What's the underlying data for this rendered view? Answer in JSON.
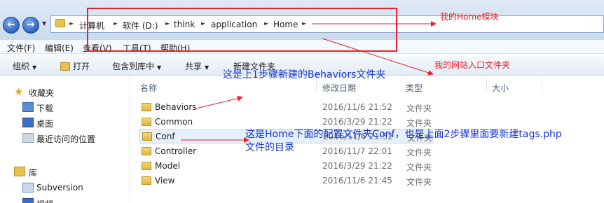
{
  "breadcrumb": {
    "items": [
      "计算机",
      "软件 (D:)",
      "think",
      "application",
      "Home"
    ]
  },
  "nav": {
    "back_icon": "back-arrow-icon",
    "forward_icon": "forward-arrow-icon"
  },
  "menubar": {
    "items": [
      "文件(F)",
      "编辑(E)",
      "查看(V)",
      "工具(T)",
      "帮助(H)"
    ]
  },
  "toolbar": {
    "organize": "组织",
    "open": "打开",
    "include_library": "包含到库中",
    "share": "共享",
    "new_folder": "新建文件夹"
  },
  "sidebar": {
    "favorites": "收藏夹",
    "items": [
      "下载",
      "桌面",
      "最近访问的位置"
    ],
    "library": "库",
    "library_items": [
      "Subversion",
      "视频"
    ]
  },
  "columns": {
    "name": "名称",
    "modified": "修改日期",
    "type": "类型",
    "size": "大小"
  },
  "files": [
    {
      "name": "Behaviors",
      "date": "2016/11/6 21:52",
      "type": "文件夹"
    },
    {
      "name": "Common",
      "date": "2016/3/29 21:22",
      "type": "文件夹"
    },
    {
      "name": "Conf",
      "date": "2016/11/6 21:52",
      "type": "文件夹"
    },
    {
      "name": "Controller",
      "date": "2016/11/7 22:01",
      "type": "文件夹"
    },
    {
      "name": "Model",
      "date": "2016/3/29 21:22",
      "type": "文件夹"
    },
    {
      "name": "View",
      "date": "2016/11/6 21:45",
      "type": "文件夹"
    }
  ],
  "annotations": {
    "home_module": "我的Home模块",
    "site_entry": "我的网站入口文件夹",
    "behaviors_note": "这是上1步骤新建的Behaviors文件夹",
    "conf_note_line1": "这是Home下面的配置文件夹Conf，也是上面2步骤里面要新建tags.php",
    "conf_note_line2": "文件的目录"
  },
  "colors": {
    "annotation_red": "#e8222a",
    "annotation_blue": "#1433d6"
  }
}
